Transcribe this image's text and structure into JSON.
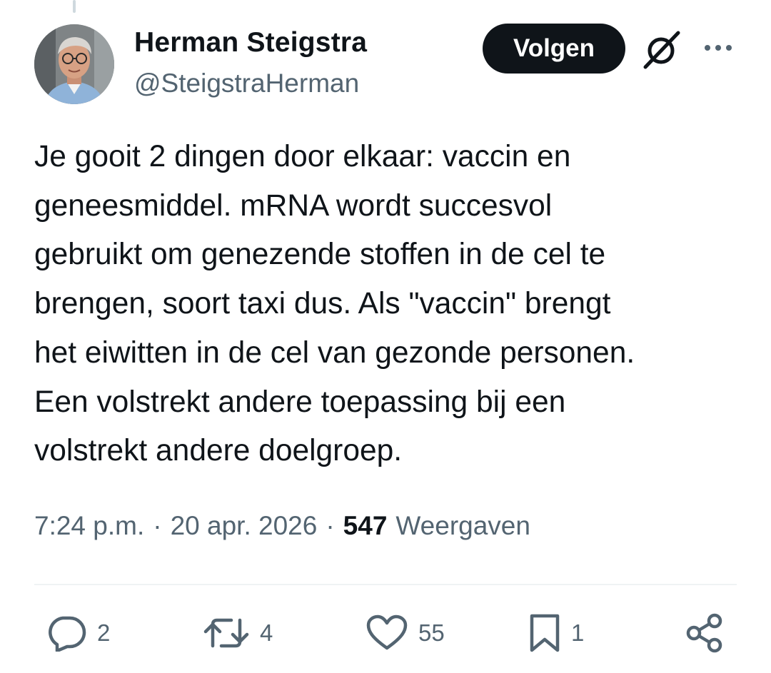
{
  "tweet": {
    "author_name": "Herman Steigstra",
    "author_handle": "@SteigstraHerman",
    "follow_label": "Volgen",
    "text": "Je gooit 2 dingen door elkaar: vaccin en\ngeneesmiddel. mRNA wordt succesvol\ngebruikt om genezende stoffen in de cel te\nbrengen, soort taxi dus. Als \"vaccin\" brengt\nhet eiwitten in de cel van gezonde personen.\nEen volstrekt andere toepassing bij een\nvolstrekt andere doelgroep.",
    "time": "7:24 p.m.",
    "separator": "·",
    "date": "20 apr. 2026",
    "views_count": "547",
    "views_label": "Weergaven"
  },
  "actions": {
    "replies": "2",
    "reposts": "4",
    "likes": "55",
    "bookmarks": "1"
  },
  "icons": {
    "grok": "grok-icon",
    "more": "more-dots-icon",
    "reply": "reply-bubble-icon",
    "repost": "repost-arrows-icon",
    "like": "heart-icon",
    "bookmark": "bookmark-icon",
    "share": "share-icon"
  },
  "colors": {
    "text": "#0f1419",
    "secondary": "#536471",
    "button_bg": "#0f1419",
    "button_text": "#ffffff",
    "divider": "#eff3f4"
  }
}
